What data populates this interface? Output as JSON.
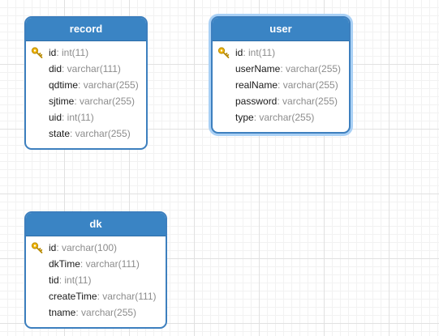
{
  "entities": {
    "record": {
      "title": "record",
      "fields": [
        {
          "name": "id",
          "type": ": int(11)",
          "pk": true
        },
        {
          "name": "did",
          "type": ": varchar(111)"
        },
        {
          "name": "qdtime",
          "type": ": varchar(255)"
        },
        {
          "name": "sjtime",
          "type": ": varchar(255)"
        },
        {
          "name": "uid",
          "type": ": int(11)"
        },
        {
          "name": "state",
          "type": ": varchar(255)"
        }
      ]
    },
    "user": {
      "title": "user",
      "selected": true,
      "fields": [
        {
          "name": "id",
          "type": ": int(11)",
          "pk": true
        },
        {
          "name": "userName",
          "type": ": varchar(255)"
        },
        {
          "name": "realName",
          "type": ": varchar(255)"
        },
        {
          "name": "password",
          "type": ": varchar(255)"
        },
        {
          "name": "type",
          "type": ": varchar(255)"
        }
      ]
    },
    "dk": {
      "title": "dk",
      "fields": [
        {
          "name": "id",
          "type": ": varchar(100)",
          "pk": true
        },
        {
          "name": "dkTime",
          "type": ": varchar(111)"
        },
        {
          "name": "tid",
          "type": ": int(11)"
        },
        {
          "name": "createTime",
          "type": ": varchar(111)"
        },
        {
          "name": "tname",
          "type": ": varchar(255)"
        }
      ]
    }
  },
  "icons": {
    "primary_key": "key-icon"
  },
  "colors": {
    "header": "#3a84c4",
    "border": "#3d7fbe",
    "selection": "#a9d0f5",
    "field_name": "#1a1a1a",
    "field_type": "#8c8c8c",
    "key": "#f0b400"
  }
}
